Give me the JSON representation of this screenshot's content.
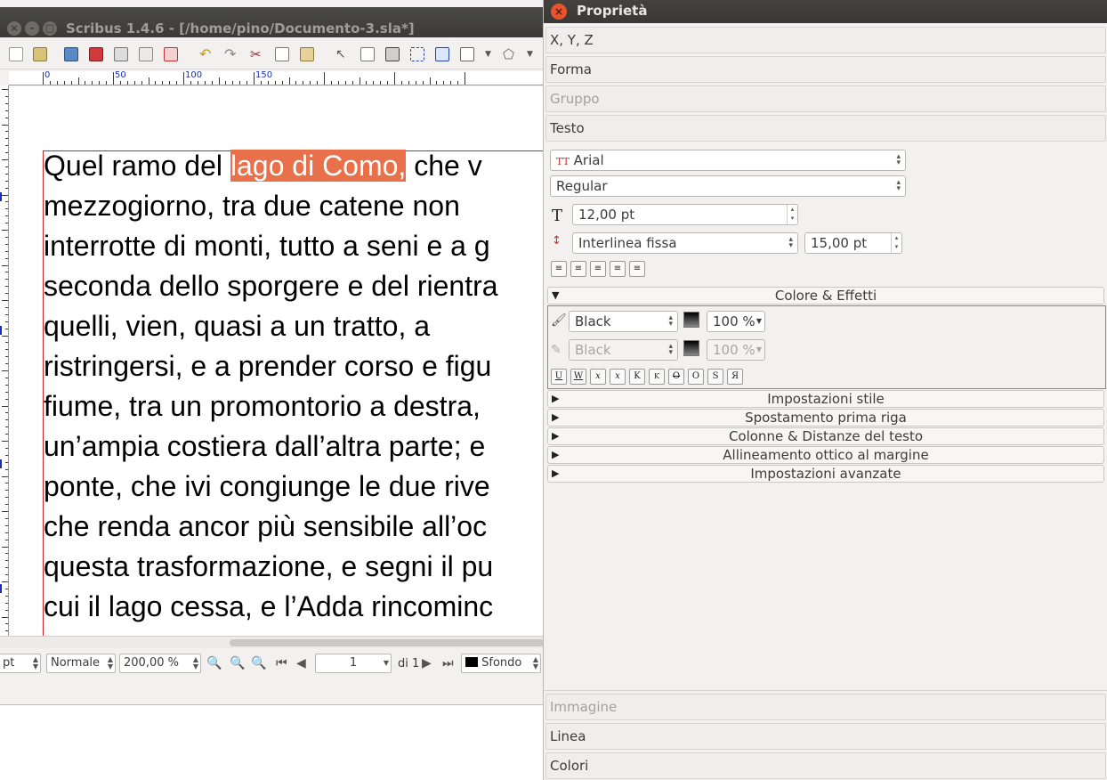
{
  "main_window": {
    "title": "Scribus 1.4.6 - [/home/pino/Documento-3.sla*]",
    "ruler_labels": [
      "0",
      "50",
      "100",
      "150"
    ],
    "document_lines": [
      {
        "before": "Quel ramo del ",
        "selected": "lago di Como,",
        "after": " che v"
      },
      {
        "before": "mezzogiorno, tra due catene non",
        "selected": "",
        "after": ""
      },
      {
        "before": "interrotte di monti, tutto a seni e a g",
        "selected": "",
        "after": ""
      },
      {
        "before": "seconda dello sporgere e del rientra",
        "selected": "",
        "after": ""
      },
      {
        "before": "quelli, vien, quasi a un tratto, a",
        "selected": "",
        "after": ""
      },
      {
        "before": "ristringersi, e a prender corso e figu",
        "selected": "",
        "after": ""
      },
      {
        "before": "fiume, tra un promontorio a destra,",
        "selected": "",
        "after": ""
      },
      {
        "before": "un’ampia costiera dall’altra parte; e",
        "selected": "",
        "after": ""
      },
      {
        "before": "ponte, che ivi congiunge le due rive",
        "selected": "",
        "after": ""
      },
      {
        "before": "che renda ancor più sensibile all’oc",
        "selected": "",
        "after": ""
      },
      {
        "before": "questa trasformazione, e segni il pu",
        "selected": "",
        "after": ""
      },
      {
        "before": "cui il lago cessa, e l’Adda rincominc",
        "selected": "",
        "after": ""
      }
    ],
    "statusbar": {
      "unit": "pt",
      "view_mode": "Normale",
      "zoom": "200,00 %",
      "page_number": "1",
      "page_total": "di 1",
      "layer": "Sfondo"
    }
  },
  "properties": {
    "title": "Proprietà",
    "sections": {
      "xyz": "X, Y, Z",
      "shape": "Forma",
      "group": "Gruppo",
      "text": "Testo",
      "image": "Immagine",
      "line": "Linea",
      "colors": "Colori"
    },
    "text": {
      "font_family": "Arial",
      "font_style": "Regular",
      "font_size": "12,00 pt",
      "line_spacing_mode": "Interlinea fissa",
      "line_spacing": "15,00 pt"
    },
    "color_effects": {
      "header": "Colore & Effetti",
      "fill_color": "Black",
      "fill_shade": "100 %",
      "stroke_color": "Black",
      "stroke_shade": "100 %",
      "style_buttons": [
        "U",
        "W",
        "x",
        "x",
        "K",
        "K",
        "O",
        "O",
        "S",
        "Я"
      ]
    },
    "collapsed_groups": [
      "Impostazioni stile",
      "Spostamento prima riga",
      "Colonne & Distanze del testo",
      "Allineamento ottico al margine",
      "Impostazioni avanzate"
    ],
    "accent_color": "#e5542f",
    "selection_color": "#e8704a"
  }
}
